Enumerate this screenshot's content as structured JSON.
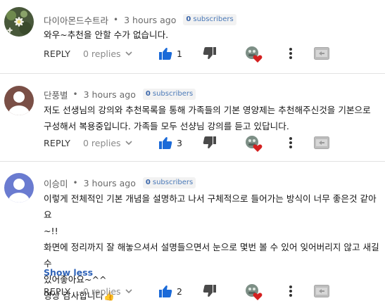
{
  "colors": {
    "accent": "#2f63b8",
    "like": "#1b6ad8",
    "heart": "#d42020"
  },
  "comments": [
    {
      "author": "다이아몬드수트라",
      "time": "3 hours ago",
      "subs_count": "0",
      "subs_label": "subscribers",
      "text": "와우~추천을 안할 수가 없습니다.",
      "reply_label": "REPLY",
      "replies_label": "0 replies",
      "likes": "1",
      "avatar_icon": "flower-photo-avatar"
    },
    {
      "author": "단풍별",
      "time": "3 hours ago",
      "subs_count": "0",
      "subs_label": "subscribers",
      "text": "저도 선생님의 강의와 추천목록을 통해 가족들의 기본 영양제는 추천해주신것을 기본으로 구성해서 복용중입니다. 가족들 모두 선샹님 강의를 듣고 있답니다.",
      "reply_label": "REPLY",
      "replies_label": "0 replies",
      "likes": "3",
      "avatar_icon": "default-person-avatar"
    },
    {
      "author": "이승미",
      "time": "3 hours ago",
      "subs_count": "0",
      "subs_label": "subscribers",
      "text_lines": [
        "이렇게 전체적인 기본 개념을 설명하고 나서 구체적으로 들어가는 방식이 너무 좋은것 같아요",
        "~!!",
        "화면에 정리까지 잘 해놓으셔서 설명들으면서 눈으로 몇번 볼 수 있어 잊어버리지 않고 새길 수",
        "있어좋아요~^^",
        "영상 감사합니다👍"
      ],
      "show_less": "Show less",
      "reply_label": "REPLY",
      "replies_label": "0 replies",
      "likes": "2",
      "avatar_icon": "default-person-avatar"
    }
  ]
}
